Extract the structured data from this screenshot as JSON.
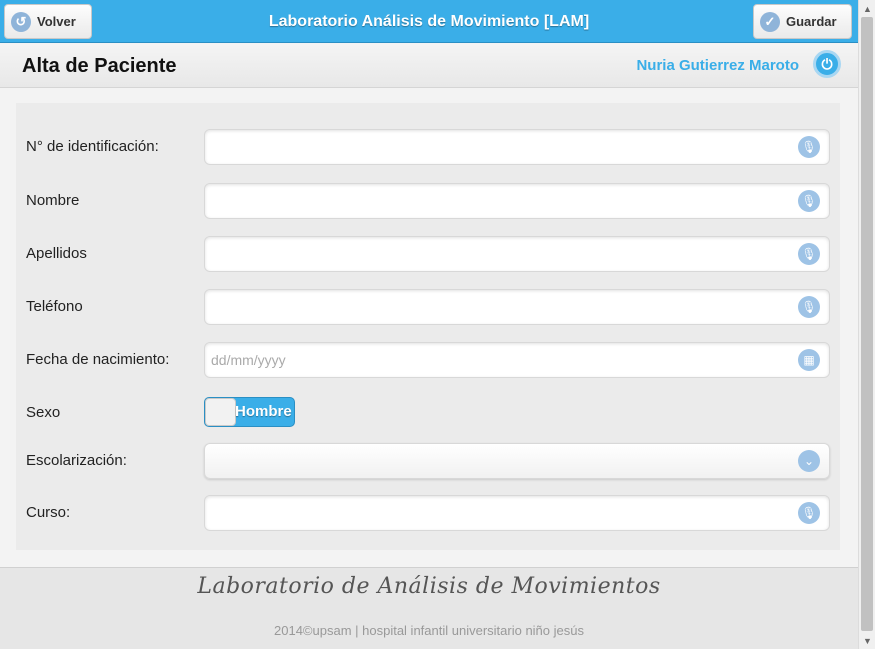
{
  "header": {
    "title": "Laboratorio Análisis de Movimiento [LAM]",
    "back_label": "Volver",
    "save_label": "Guardar"
  },
  "subheader": {
    "page_title": "Alta de Paciente",
    "user_name": "Nuria Gutierrez Maroto"
  },
  "form": {
    "id_label": "N° de identificación:",
    "name_label": "Nombre",
    "surname_label": "Apellidos",
    "phone_label": "Teléfono",
    "birth_label": "Fecha de nacimiento:",
    "birth_placeholder": "dd/mm/yyyy",
    "sex_label": "Sexo",
    "sex_value": "Hombre",
    "school_label": "Escolarización:",
    "course_label": "Curso:"
  },
  "footer": {
    "brand": "Laboratorio de Análisis de Movimientos",
    "copyright": "2014©upsam | hospital infantil universitario niño jesús"
  },
  "colors": {
    "accent": "#3aaee8",
    "icon": "#9ec3e6"
  }
}
